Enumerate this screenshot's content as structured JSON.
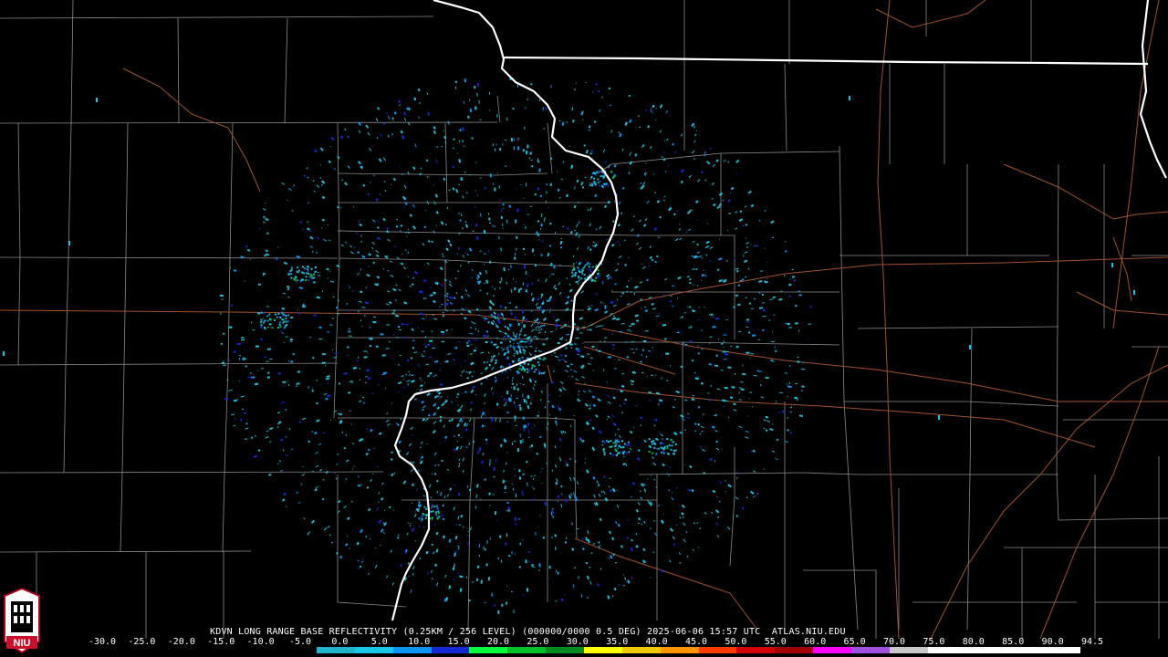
{
  "product": {
    "caption": "KDVN LONG RANGE BASE REFLECTIVITY (0.25KM / 256 LEVEL) (000000/0000 0.5 DEG) 2025-06-06 15:57 UTC  ATLAS.NIU.EDU",
    "logo_text": "NIU"
  },
  "colorbar": {
    "labels": [
      "-30.0",
      "-25.0",
      "-20.0",
      "-15.0",
      "-10.0",
      "-5.0",
      "0.0",
      "5.0",
      "10.0",
      "15.0",
      "20.0",
      "25.0",
      "30.0",
      "35.0",
      "40.0",
      "45.0",
      "50.0",
      "55.0",
      "60.0",
      "65.0",
      "70.0",
      "75.0",
      "80.0",
      "85.0",
      "90.0",
      "94.5"
    ],
    "colors": [
      "#000000",
      "#000000",
      "#000000",
      "#000000",
      "#000000",
      "#000000",
      "#1fb4c8",
      "#18c8e8",
      "#0a96f0",
      "#1428d8",
      "#00ff3c",
      "#00c02a",
      "#008c1e",
      "#ffff00",
      "#f0c800",
      "#ff9600",
      "#ff3c00",
      "#d20000",
      "#a00000",
      "#ff00ff",
      "#a050e0",
      "#c8c8c8",
      "#ffffff",
      "#ffffff",
      "#ffffff",
      "#ffffff"
    ]
  },
  "map": {
    "colors": {
      "background": "#000000",
      "county_lines": "#8a8a8a",
      "state_lines": "#ffffff",
      "highways": "#a0522d",
      "echo_light": "#1fb4c8",
      "echo_mid": "#18c8e8",
      "echo_strong": "#0a96f0",
      "echo_core": "#1428d8",
      "echo_green": "#00c02a"
    },
    "radar_site": "KDVN"
  }
}
